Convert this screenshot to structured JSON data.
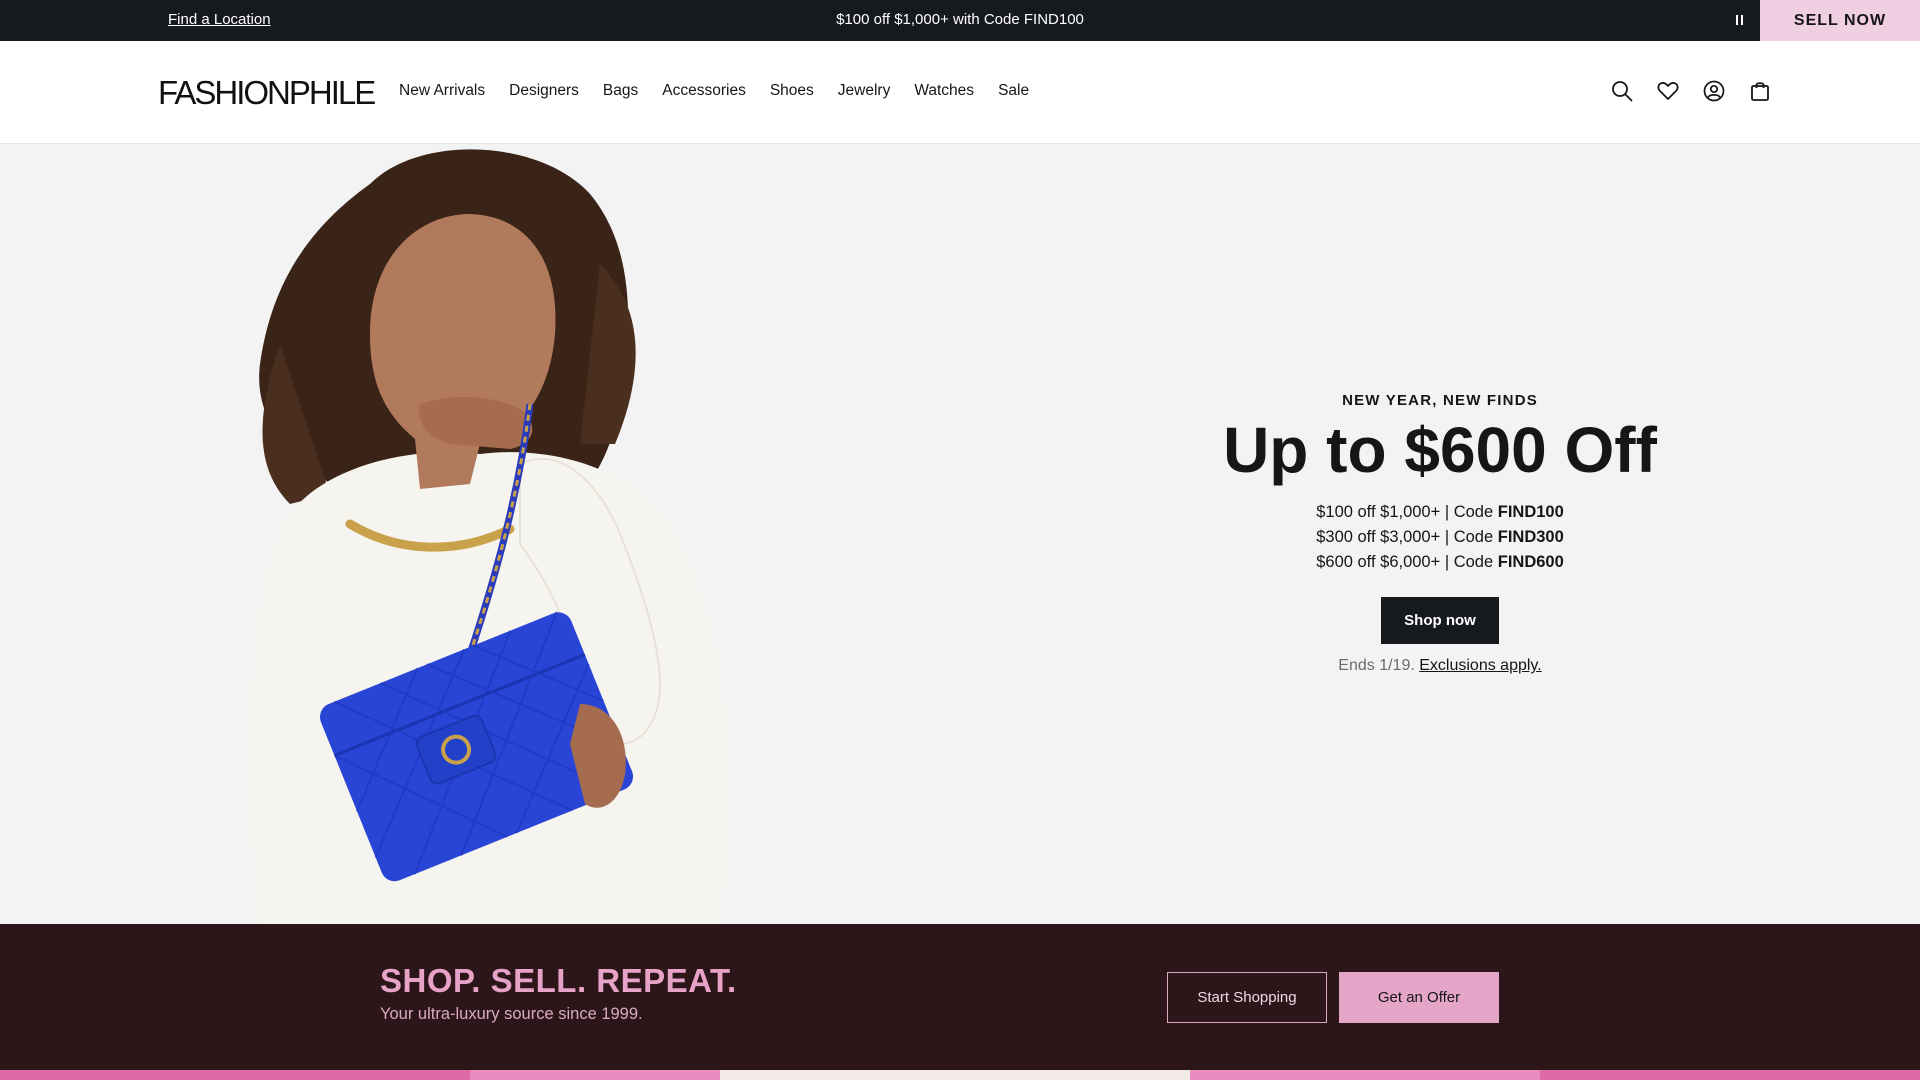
{
  "announcement": {
    "find_location": "Find a Location",
    "promo_text": "$100 off $1,000+ with Code FIND100",
    "sell_now": "SELL NOW"
  },
  "header": {
    "logo": "FASHIONPHILE",
    "nav": [
      "New Arrivals",
      "Designers",
      "Bags",
      "Accessories",
      "Shoes",
      "Jewelry",
      "Watches",
      "Sale"
    ],
    "icons": [
      "search-icon",
      "heart-icon",
      "account-icon",
      "bag-icon"
    ]
  },
  "hero": {
    "eyebrow": "NEW YEAR, NEW FINDS",
    "headline": "Up to $600 Off",
    "codes": [
      {
        "text": "$100 off $1,000+ | Code ",
        "code": "FIND100"
      },
      {
        "text": "$300 off $3,000+ | Code ",
        "code": "FIND300"
      },
      {
        "text": "$600 off $6,000+ | Code ",
        "code": "FIND600"
      }
    ],
    "cta": "Shop now",
    "ends": "Ends 1/19.",
    "exclusions": "Exclusions apply."
  },
  "band": {
    "tagline": "SHOP. SELL. REPEAT.",
    "subtitle": "Your ultra-luxury source since 1999.",
    "start_shopping": "Start Shopping",
    "get_offer": "Get an Offer"
  },
  "colors": {
    "announce_bg": "#16191e",
    "sell_now_bg": "#f1cfe2",
    "band_bg": "#2d161a",
    "band_accent": "#e7a3c7",
    "hero_bg": "#f3f3f3"
  }
}
